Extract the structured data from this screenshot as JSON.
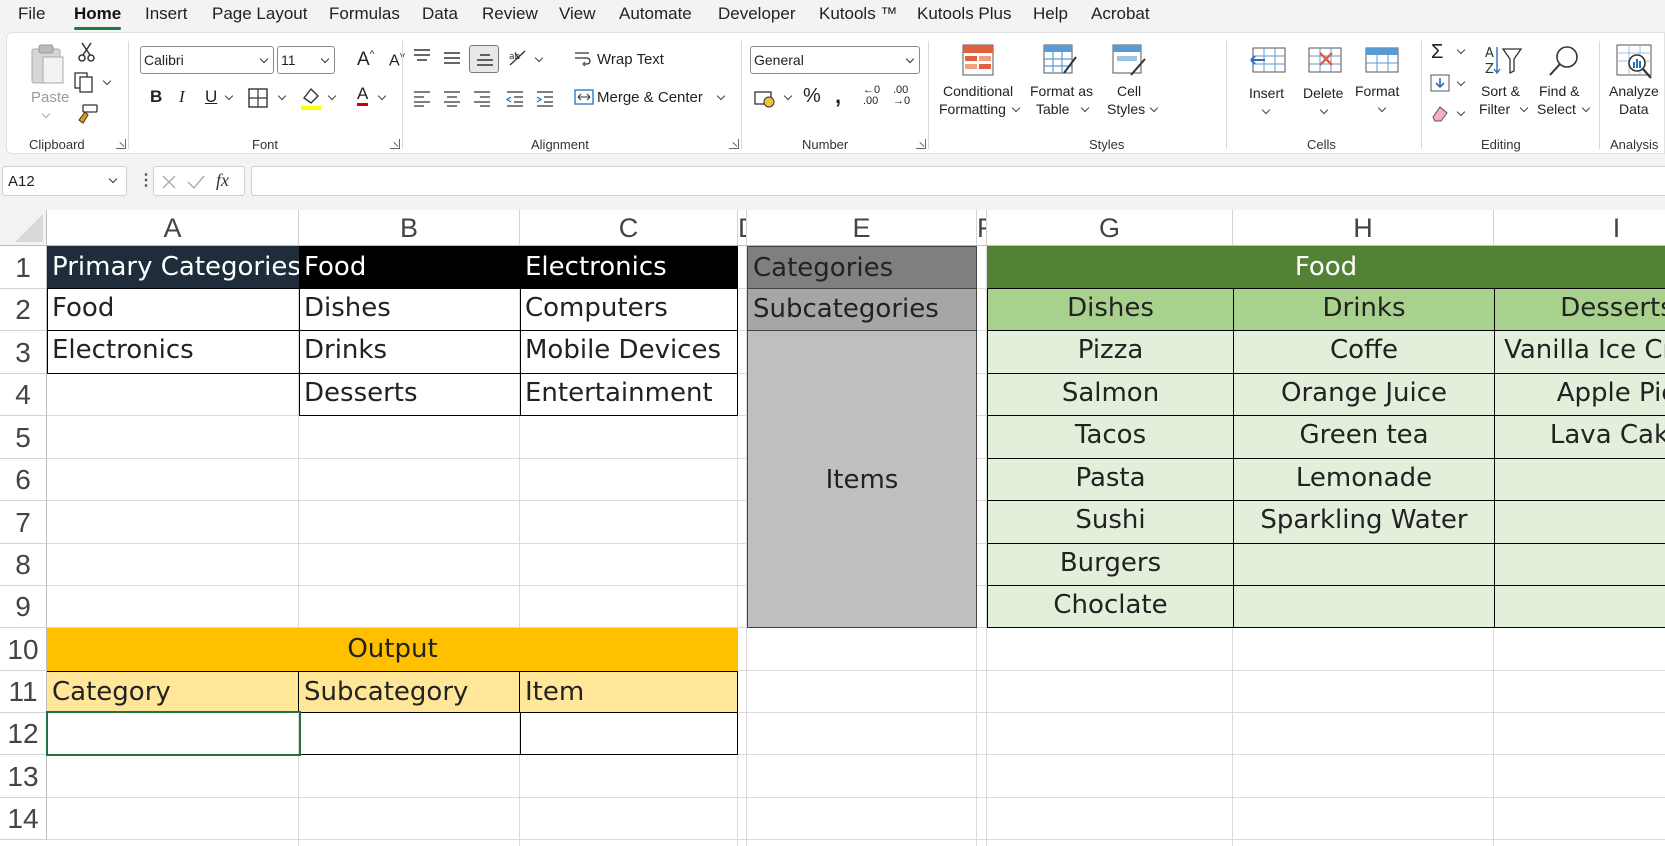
{
  "menu": {
    "tabs": [
      "File",
      "Home",
      "Insert",
      "Page Layout",
      "Formulas",
      "Data",
      "Review",
      "View",
      "Automate",
      "Developer",
      "Kutools ™",
      "Kutools Plus",
      "Help",
      "Acrobat"
    ],
    "active": "Home"
  },
  "ribbon": {
    "clipboard": {
      "paste": "Paste",
      "group": "Clipboard"
    },
    "font": {
      "name": "Calibri",
      "size": "11",
      "group": "Font"
    },
    "alignment": {
      "wrap": "Wrap Text",
      "merge": "Merge & Center",
      "group": "Alignment"
    },
    "number": {
      "format": "General",
      "group": "Number"
    },
    "styles": {
      "conditional": [
        "Conditional",
        "Formatting"
      ],
      "format_table": [
        "Format as",
        "Table"
      ],
      "cell_styles": [
        "Cell",
        "Styles"
      ],
      "group": "Styles"
    },
    "cells": {
      "insert": "Insert",
      "delete": "Delete",
      "format": "Format",
      "group": "Cells"
    },
    "editing": {
      "sort": [
        "Sort &",
        "Filter"
      ],
      "find": [
        "Find &",
        "Select"
      ],
      "group": "Editing"
    },
    "analysis": {
      "analyze": [
        "Analyze",
        "Data"
      ],
      "group": "Analysis"
    }
  },
  "formula_bar": {
    "name_box": "A12",
    "fx": "fx",
    "content": ""
  },
  "grid": {
    "columns": [
      "A",
      "B",
      "C",
      "D",
      "E",
      "F",
      "G",
      "H",
      "I"
    ],
    "rows": [
      "1",
      "2",
      "3",
      "4",
      "5",
      "6",
      "7",
      "8",
      "9",
      "10",
      "11",
      "12",
      "13",
      "14"
    ]
  },
  "sheet": {
    "primary_table": {
      "header": [
        "Primary Categories",
        "Food",
        "Electronics"
      ],
      "col_a": [
        "Food",
        "Electronics",
        ""
      ],
      "col_b": [
        "Dishes",
        "Drinks",
        "Desserts"
      ],
      "col_c": [
        "Computers",
        "Mobile Devices",
        "Entertainment"
      ]
    },
    "output": {
      "title": "Output",
      "headers": [
        "Category",
        "Subcategory",
        "Item"
      ]
    },
    "legend": {
      "categories": "Categories",
      "subcategories": "Subcategories",
      "items": "Items"
    },
    "food_table": {
      "title": "Food",
      "subcategories": [
        "Dishes",
        "Drinks",
        "Desserts"
      ],
      "dishes": [
        "Pizza",
        "Salmon",
        "Tacos",
        "Pasta",
        "Sushi",
        "Burgers",
        "Choclate"
      ],
      "drinks": [
        "Coffe",
        "Orange Juice",
        "Green tea",
        "Lemonade",
        "Sparkling Water",
        "",
        ""
      ],
      "desserts": [
        "Vanilla Ice Cream",
        "Apple Pie",
        "Lava Cake",
        "",
        "",
        "",
        ""
      ]
    }
  },
  "colors": {
    "accent": "#1d7a45",
    "header_black": "#000000",
    "header_dark_blue": "#1f2d3a",
    "category_gray": "#7f7f7f",
    "subcategory_gray": "#a6a6a6",
    "items_gray": "#bfbfbf",
    "food_green": "#548235",
    "sub_green": "#a9d18e",
    "item_green": "#e2efda",
    "output_orange": "#ffc000",
    "output_light": "#ffe699"
  }
}
